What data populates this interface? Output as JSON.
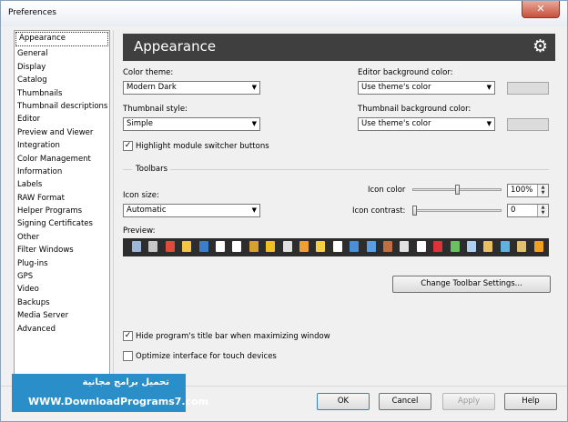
{
  "window": {
    "title": "Preferences",
    "close_glyph": "✕"
  },
  "sidebar": {
    "items": [
      {
        "label": "Appearance"
      },
      {
        "label": "General"
      },
      {
        "label": "Display"
      },
      {
        "label": "Catalog"
      },
      {
        "label": "Thumbnails"
      },
      {
        "label": "Thumbnail descriptions"
      },
      {
        "label": "Editor"
      },
      {
        "label": "Preview and Viewer"
      },
      {
        "label": "Integration"
      },
      {
        "label": "Color Management"
      },
      {
        "label": "Information"
      },
      {
        "label": "Labels"
      },
      {
        "label": "RAW Format"
      },
      {
        "label": "Helper Programs"
      },
      {
        "label": "Signing Certificates"
      },
      {
        "label": "Other"
      },
      {
        "label": "Filter Windows"
      },
      {
        "label": "Plug-ins"
      },
      {
        "label": "GPS"
      },
      {
        "label": "Video"
      },
      {
        "label": "Backups"
      },
      {
        "label": "Media Server"
      },
      {
        "label": "Advanced"
      }
    ]
  },
  "header": {
    "title": "Appearance",
    "gear_glyph": "⚙"
  },
  "color_theme": {
    "label": "Color theme:",
    "value": "Modern Dark"
  },
  "editor_bg": {
    "label": "Editor background color:",
    "value": "Use theme's color"
  },
  "thumb_style": {
    "label": "Thumbnail style:",
    "value": "Simple"
  },
  "thumb_bg": {
    "label": "Thumbnail background color:",
    "value": "Use theme's color"
  },
  "highlight_switcher": {
    "label": "Highlight module switcher buttons",
    "checked": true,
    "mark": "✓"
  },
  "toolbars": {
    "section_label": "Toolbars",
    "icon_size_label": "Icon size:",
    "icon_size_value": "Automatic",
    "icon_color_label": "Icon color",
    "icon_color_value": "100%",
    "icon_color_level": 0.5,
    "icon_contrast_label": "Icon contrast:",
    "icon_contrast_value": "0",
    "icon_contrast_level": 0.0,
    "preview_label": "Preview:",
    "change_button": "Change Toolbar Settings..."
  },
  "preview_icon_colors": [
    "#9cb7d8",
    "#c8c8c8",
    "#e04a3a",
    "#f4c542",
    "#3d7ecb",
    "#ffffff",
    "#ffffff",
    "#d8a030",
    "#f0c020",
    "#e0e0e0",
    "#f0a030",
    "#f5d040",
    "#ffffff",
    "#4a90d9",
    "#5aa0e0",
    "#c07040",
    "#e0e0e0",
    "#ffffff",
    "#e0303a",
    "#6ac060",
    "#b0d0f0",
    "#e8c060",
    "#60b0e0",
    "#e0c070",
    "#f0a020"
  ],
  "options": {
    "hide_titlebar": {
      "label": "Hide program's title bar when maximizing window",
      "checked": true,
      "mark": "✓"
    },
    "touch": {
      "label": "Optimize interface for touch devices",
      "checked": false,
      "mark": ""
    }
  },
  "buttons": {
    "ok": "OK",
    "cancel": "Cancel",
    "apply": "Apply",
    "help": "Help"
  },
  "watermark": {
    "line1": "تحميل برامج مجانية",
    "line2": "WWW.DownloadPrograms7.com"
  }
}
